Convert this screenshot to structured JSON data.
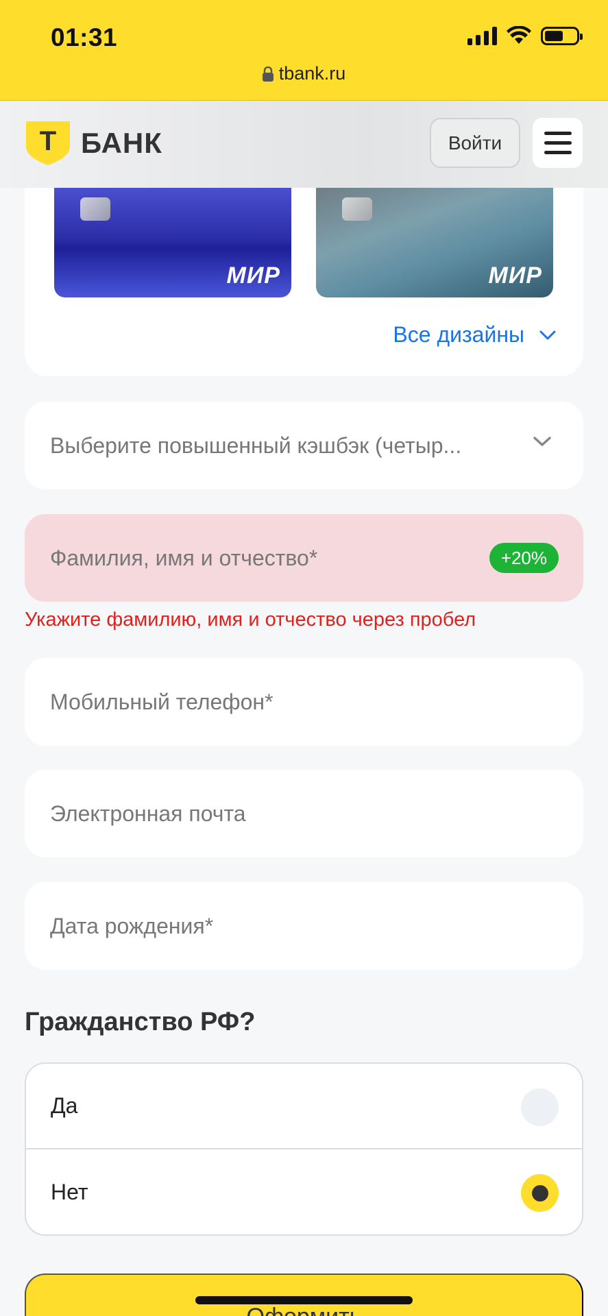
{
  "status_bar": {
    "time": "01:31",
    "url": "tbank.ru",
    "battery_level": 0.6
  },
  "header": {
    "logo_letter": "Т",
    "logo_text": "БАНК",
    "login_label": "Войти",
    "menu_icon": "hamburger-icon"
  },
  "designs": {
    "cards": [
      {
        "brand": "МИР"
      },
      {
        "brand": "МИР"
      }
    ],
    "all_designs_label": "Все дизайны"
  },
  "form": {
    "cashback_placeholder": "Выберите повышенный кэшбэк (четыр...",
    "fio_placeholder": "Фамилия, имя и отчество*",
    "fio_badge": "+20%",
    "fio_error": "Укажите фамилию, имя и отчество через пробел",
    "phone_placeholder": "Мобильный телефон*",
    "email_placeholder": "Электронная почта",
    "birth_placeholder": "Дата рождения*",
    "citizenship": {
      "title": "Гражданство РФ?",
      "options": [
        {
          "label": "Да",
          "selected": false
        },
        {
          "label": "Нет",
          "selected": true
        }
      ]
    },
    "submit_label": "Оформить"
  },
  "colors": {
    "brand_yellow": "#ffdd2d",
    "link_blue": "#1a73e8",
    "error_red": "#e0211d",
    "badge_green": "#1db336",
    "error_field_bg": "#f5d9dc"
  }
}
